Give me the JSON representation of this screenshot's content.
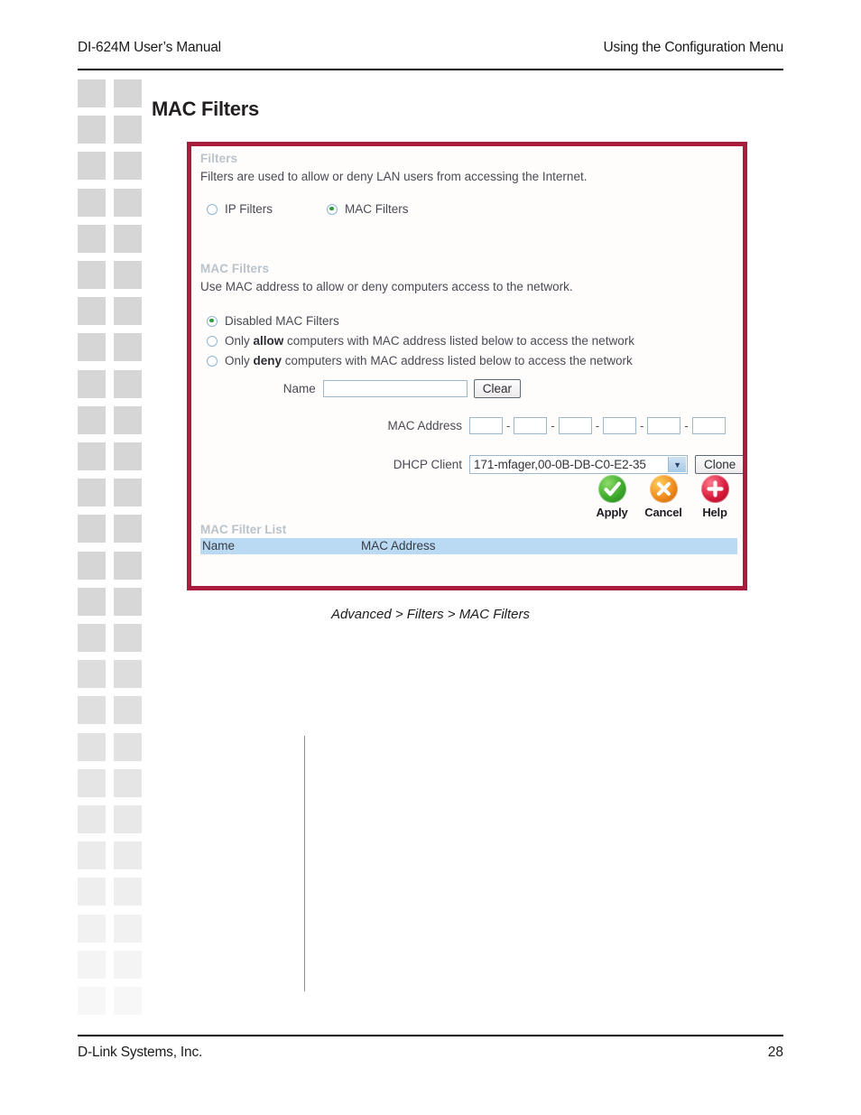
{
  "header": {
    "left": "DI-624M User’s Manual",
    "right": "Using the Configuration Menu"
  },
  "section": {
    "title": "MAC Filters"
  },
  "router_ui": {
    "filters": {
      "group_title": "Filters",
      "description": "Filters are used to allow or deny LAN users from accessing the Internet.",
      "options": [
        {
          "label": "IP Filters",
          "selected": false
        },
        {
          "label": "MAC Filters",
          "selected": true
        }
      ]
    },
    "mac_filters": {
      "group_title": "MAC Filters",
      "description": "Use MAC address to allow or deny computers access to the network.",
      "modes": [
        {
          "label": "Disabled MAC Filters",
          "selected": true
        },
        {
          "label_pre": "Only ",
          "label_bold": "allow",
          "label_post": " computers with MAC address listed below to access the network",
          "selected": false
        },
        {
          "label_pre": "Only ",
          "label_bold": "deny",
          "label_post": " computers with MAC address listed below to access the network",
          "selected": false
        }
      ],
      "name_field": {
        "label": "Name",
        "value": "",
        "button": "Clear"
      },
      "mac_address_field": {
        "label": "MAC Address",
        "octets": [
          "",
          "",
          "",
          "",
          "",
          ""
        ],
        "separator": "-"
      },
      "dhcp_client_field": {
        "label": "DHCP Client",
        "selected_option": "171-mfager,00-0B-DB-C0-E2-35",
        "dropdown_arrow": "chevron-down-icon",
        "button": "Clone"
      }
    },
    "actions": [
      {
        "label": "Apply",
        "icon": "check-circle-icon",
        "color": "#3faa2c"
      },
      {
        "label": "Cancel",
        "icon": "x-circle-icon",
        "color": "#f08b1c"
      },
      {
        "label": "Help",
        "icon": "plus-circle-icon",
        "color": "#d81b3c"
      }
    ],
    "mac_filter_list": {
      "title": "MAC Filter List",
      "columns": [
        "Name",
        "MAC Address"
      ],
      "rows": []
    }
  },
  "caption": "Advanced > Filters > MAC Filters",
  "footer": {
    "left": "D-Link Systems, Inc.",
    "page_number": "28"
  }
}
